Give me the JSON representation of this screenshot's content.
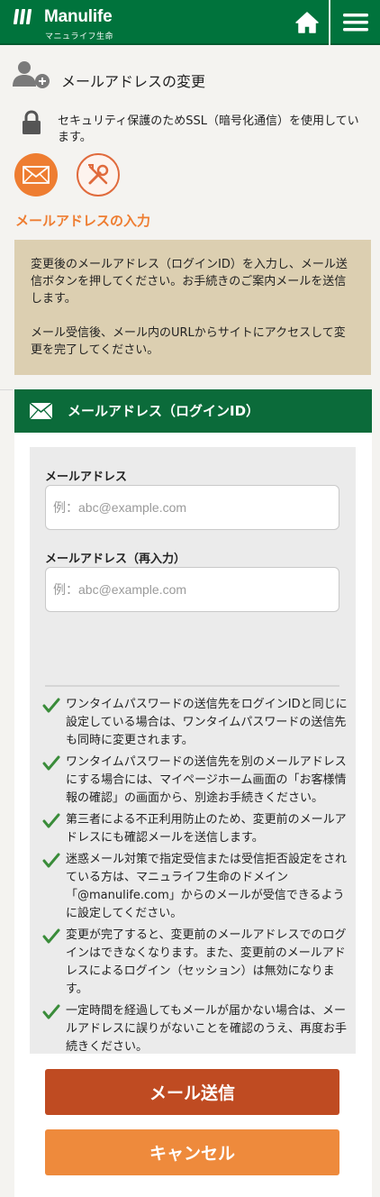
{
  "header": {
    "brand": "Manulife",
    "brand_sub": "マニュライフ生命",
    "home_icon": "home-icon",
    "menu_icon": "hamburger-menu-icon",
    "brand_color": "#00733c"
  },
  "page": {
    "title": "メールアドレスの変更",
    "ssl_notice": "セキュリティ保護のためSSL（暗号化通信）を使用しています。",
    "section_heading": "メールアドレスの入力",
    "info": [
      "変更後のメールアドレス（ログインID）を入力し、メール送信ボタンを押してください。お手続きのご案内メールを送信します。",
      "メール受信後、メール内のURLからサイトにアクセスして変更を完了してください。"
    ]
  },
  "card": {
    "title": "メールアドレス（ログインID）",
    "email_label": "メールアドレス",
    "email_placeholder": "例：abc@example.com",
    "email_value": "",
    "confirm_label": "メールアドレス（再入力）",
    "confirm_placeholder": "例：abc@example.com",
    "confirm_value": "",
    "notes": [
      "ワンタイムパスワードの送信先をログインIDと同じに設定している場合は、ワンタイムパスワードの送信先も同時に変更されます。",
      "ワンタイムパスワードの送信先を別のメールアドレスにする場合には、マイページホーム画面の「お客様情報の確認」の画面から、別途お手続きください。",
      "第三者による不正利用防止のため、変更前のメールアドレスにも確認メールを送信します。",
      "迷惑メール対策で指定受信または受信拒否設定をされている方は、マニュライフ生命のドメイン「@manulife.com」からのメールが受信できるように設定してください。",
      "変更が完了すると、変更前のメールアドレスでのログインはできなくなります。また、変更前のメールアドレスによるログイン（セッション）は無効になります。",
      "一定時間を経過してもメールが届かない場合は、メールアドレスに誤りがないことを確認のうえ、再度お手続きください。"
    ],
    "send_button": "メール送信",
    "cancel_button": "キャンセル"
  },
  "colors": {
    "accent_orange": "#ee7d31",
    "send_button": "#bf4b22",
    "cancel_button": "#ee8a3c",
    "check_green": "#3a8c3a",
    "info_bg": "#dccfb1"
  }
}
